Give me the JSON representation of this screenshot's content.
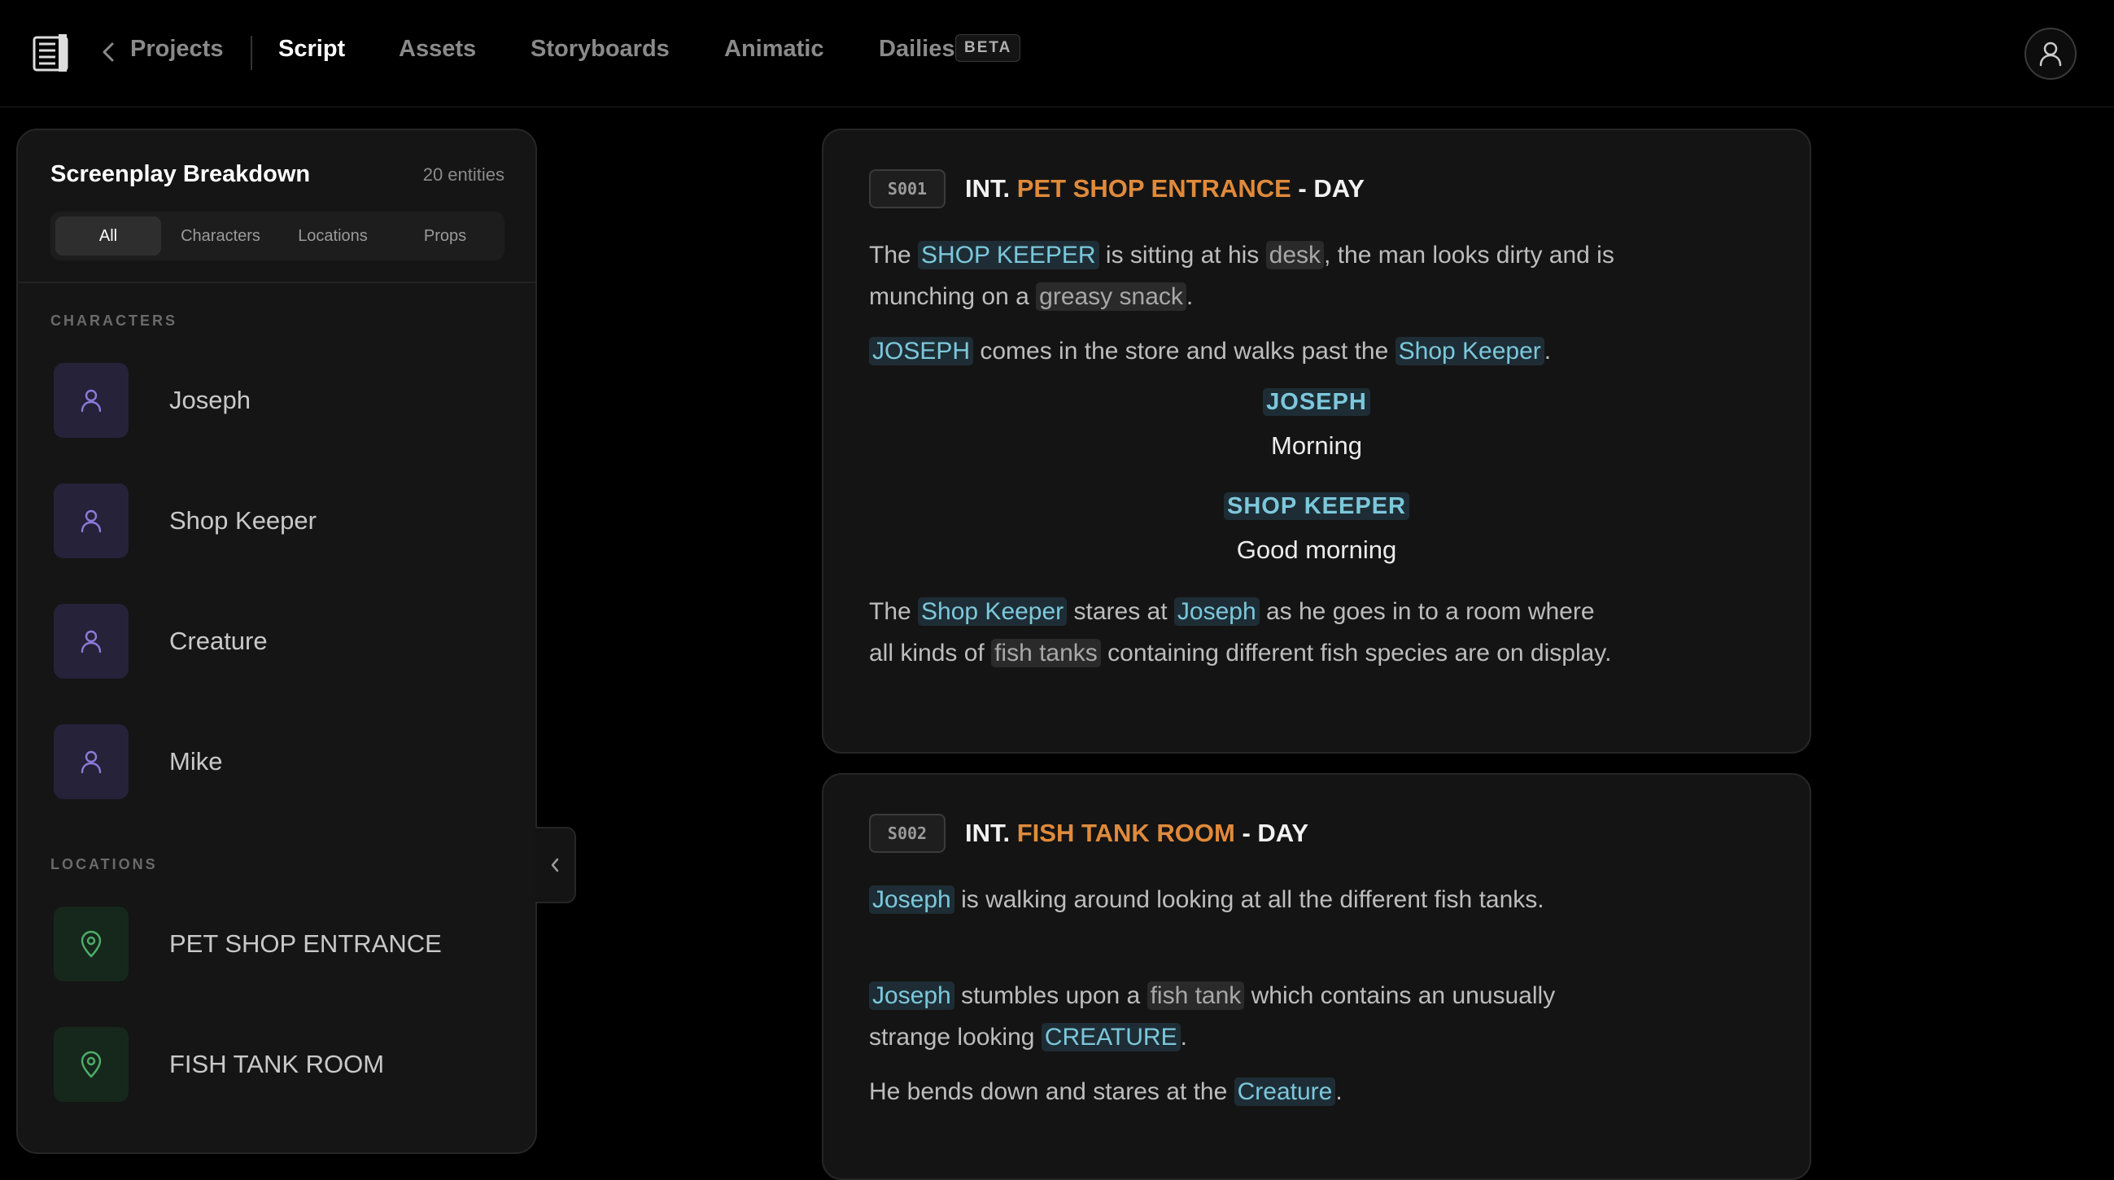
{
  "nav": {
    "projects": "Projects",
    "tabs": [
      "Script",
      "Assets",
      "Storyboards",
      "Animatic",
      "Dailies"
    ],
    "active_tab": "Script",
    "beta": "BETA"
  },
  "sidebar": {
    "title": "Screenplay Breakdown",
    "count": "20 entities",
    "filters": [
      "All",
      "Characters",
      "Locations",
      "Props"
    ],
    "active_filter": "All",
    "characters_label": "CHARACTERS",
    "characters": [
      "Joseph",
      "Shop Keeper",
      "Creature",
      "Mike"
    ],
    "locations_label": "LOCATIONS",
    "locations": [
      "PET SHOP ENTRANCE",
      "FISH TANK ROOM"
    ]
  },
  "colors": {
    "character_highlight": "#7cc8dc",
    "location_highlight": "#e08a3a",
    "prop_highlight": "#a8a8a8",
    "character_icon": "#8d7ad8",
    "location_icon": "#4fae6a"
  },
  "scenes": [
    {
      "id": "S001",
      "int": "INT.",
      "location": "PET SHOP ENTRANCE",
      "time": "- DAY",
      "p1": {
        "t1": "The ",
        "c1": "SHOP KEEPER",
        "t2": " is sitting at his ",
        "pr1": "desk",
        "t3": ", the man looks dirty and is munching on a ",
        "pr2": "greasy snack",
        "t4": "."
      },
      "p2": {
        "c1": "JOSEPH",
        "t1": " comes in the store and walks past the ",
        "c2": "Shop Keeper",
        "t2": "."
      },
      "d1": {
        "cue": "JOSEPH",
        "line": "Morning"
      },
      "d2": {
        "cue": "SHOP KEEPER",
        "line": "Good morning"
      },
      "p3": {
        "t1": "The ",
        "c1": "Shop Keeper",
        "t2": " stares at ",
        "c2": "Joseph",
        "t3": " as he goes in to a room where all kinds of ",
        "pr1": "fish tanks",
        "t4": " containing different fish species are on display."
      }
    },
    {
      "id": "S002",
      "int": "INT.",
      "location": "FISH TANK ROOM",
      "time": "- DAY",
      "p1": {
        "c1": "Joseph",
        "t1": " is walking around looking at all the different fish tanks."
      },
      "p2": {
        "c1": "Joseph",
        "t1": " stumbles upon a ",
        "pr1": "fish tank",
        "t2": " which contains an unusually strange looking ",
        "c2": "CREATURE",
        "t3": "."
      },
      "p3": {
        "t1": "He bends down and stares at the ",
        "c1": "Creature",
        "t2": "."
      }
    }
  ]
}
